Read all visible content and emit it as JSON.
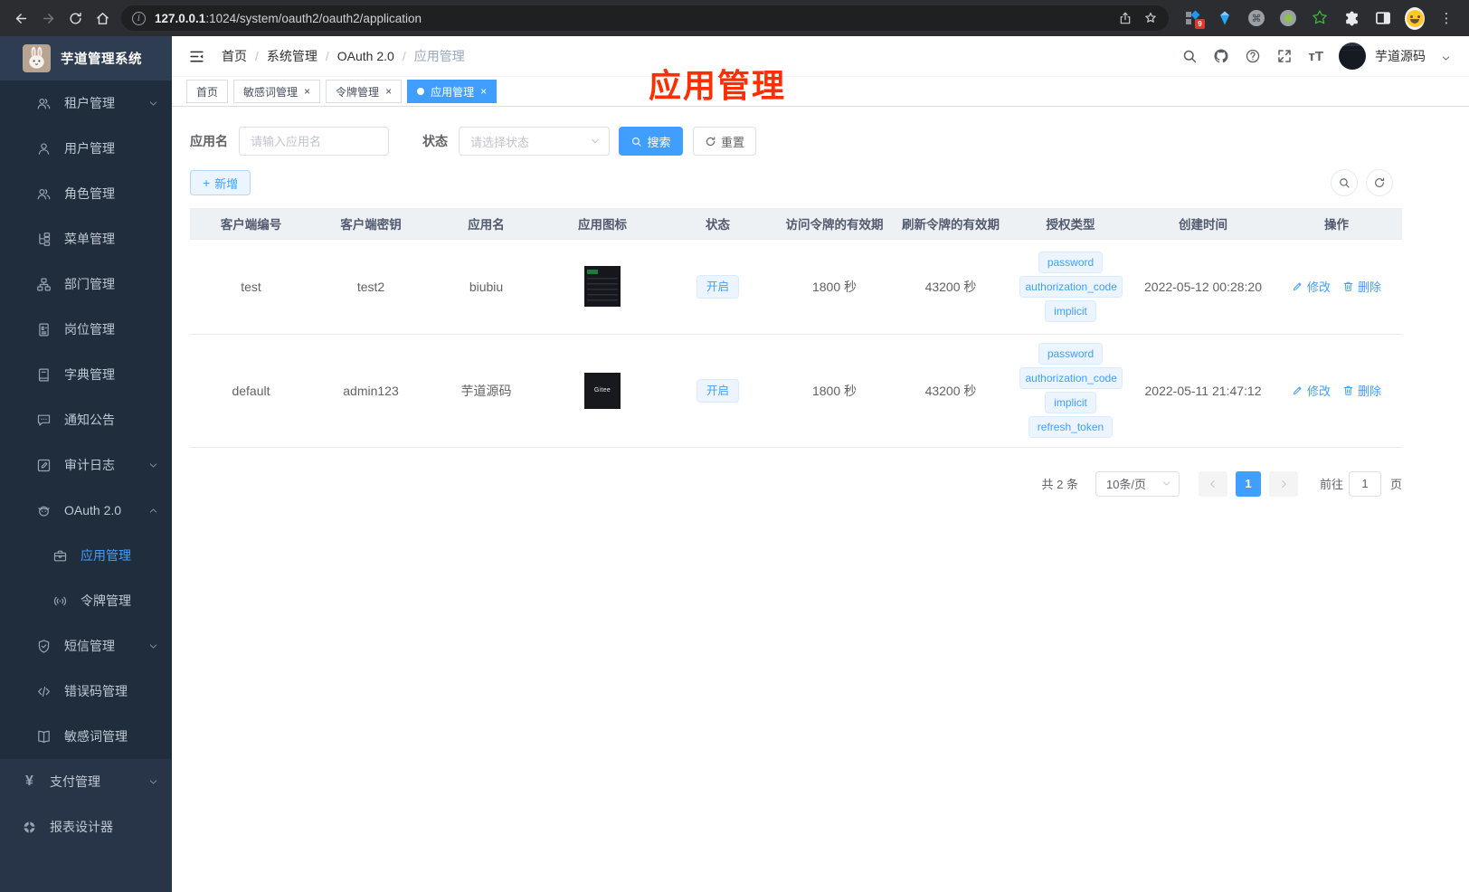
{
  "browser": {
    "url_host": "127.0.0.1",
    "url_path": ":1024/system/oauth2/oauth2/application",
    "extension_badge": "9"
  },
  "icons": {
    "info": "i",
    "command": "⌘",
    "kebab": "⋮",
    "plus": "+",
    "close": "×",
    "slash": "/",
    "yen": "¥",
    "fontsize": "тT"
  },
  "sidebar": {
    "title": "芋道管理系统",
    "items": [
      {
        "label": "租户管理",
        "icon": "users"
      },
      {
        "label": "用户管理",
        "icon": "user"
      },
      {
        "label": "角色管理",
        "icon": "users"
      },
      {
        "label": "菜单管理",
        "icon": "menu-tree"
      },
      {
        "label": "部门管理",
        "icon": "org"
      },
      {
        "label": "岗位管理",
        "icon": "badge"
      },
      {
        "label": "字典管理",
        "icon": "dictionary"
      },
      {
        "label": "通知公告",
        "icon": "message"
      },
      {
        "label": "审计日志",
        "icon": "log"
      },
      {
        "label": "OAuth 2.0",
        "icon": "robot"
      },
      {
        "label": "应用管理",
        "icon": "briefcase"
      },
      {
        "label": "令牌管理",
        "icon": "signal"
      },
      {
        "label": "短信管理",
        "icon": "shield"
      },
      {
        "label": "错误码管理",
        "icon": "code"
      },
      {
        "label": "敏感词管理",
        "icon": "book-open"
      },
      {
        "label": "支付管理",
        "icon": "yen"
      },
      {
        "label": "报表设计器",
        "icon": "report"
      }
    ]
  },
  "navbar": {
    "breadcrumbs": [
      "首页",
      "系统管理",
      "OAuth 2.0",
      "应用管理"
    ],
    "username": "芋道源码"
  },
  "tabs": [
    {
      "label": "首页"
    },
    {
      "label": "敏感词管理"
    },
    {
      "label": "令牌管理"
    },
    {
      "label": "应用管理"
    }
  ],
  "annotation": "应用管理",
  "filter": {
    "app_name_label": "应用名",
    "app_name_placeholder": "请输入应用名",
    "status_label": "状态",
    "status_placeholder": "请选择状态",
    "search_label": "搜索",
    "reset_label": "重置"
  },
  "toolbar": {
    "add_label": "新增"
  },
  "table": {
    "headers": [
      "客户端编号",
      "客户端密钥",
      "应用名",
      "应用图标",
      "状态",
      "访问令牌的有效期",
      "刷新令牌的有效期",
      "授权类型",
      "创建时间",
      "操作"
    ],
    "edit_label": "修改",
    "delete_label": "删除",
    "rows": [
      {
        "client_id": "test",
        "client_secret": "test2",
        "name": "biubiu",
        "icon_label": "",
        "status": "开启",
        "access_ttl": "1800 秒",
        "refresh_ttl": "43200 秒",
        "grants": [
          "password",
          "authorization_code",
          "implicit"
        ],
        "created": "2022-05-12 00:28:20"
      },
      {
        "client_id": "default",
        "client_secret": "admin123",
        "name": "芋道源码",
        "icon_label": "Gitee",
        "status": "开启",
        "access_ttl": "1800 秒",
        "refresh_ttl": "43200 秒",
        "grants": [
          "password",
          "authorization_code",
          "implicit",
          "refresh_token"
        ],
        "created": "2022-05-11 21:47:12"
      }
    ]
  },
  "pagination": {
    "total_label": "共 2 条",
    "page_size_label": "10条/页",
    "current_page": "1",
    "goto_label": "前往",
    "goto_value": "1",
    "unit_label": "页"
  },
  "colors": {
    "accent": "#409eff",
    "annotation_red": "#fd2f02",
    "sidebar_bg": "#1f2d3d",
    "tag_bg": "#ecf5ff",
    "tag_border": "#d9ecff"
  }
}
